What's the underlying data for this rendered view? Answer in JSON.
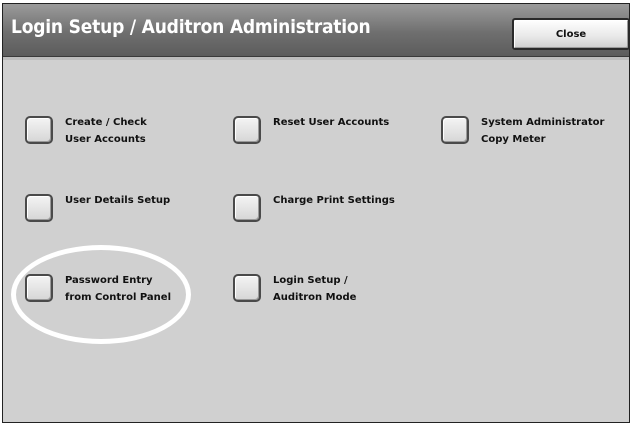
{
  "header": {
    "title": "Login Setup / Auditron Administration",
    "close_label": "Close"
  },
  "options": {
    "create_check": "Create / Check\nUser Accounts",
    "reset_accounts": "Reset User Accounts",
    "sysadmin_meter": "System Administrator\nCopy Meter",
    "user_details": "User Details Setup",
    "charge_print": "Charge Print Settings",
    "password_entry": "Password Entry\nfrom Control Panel",
    "login_mode": "Login Setup /\nAuditron Mode"
  }
}
